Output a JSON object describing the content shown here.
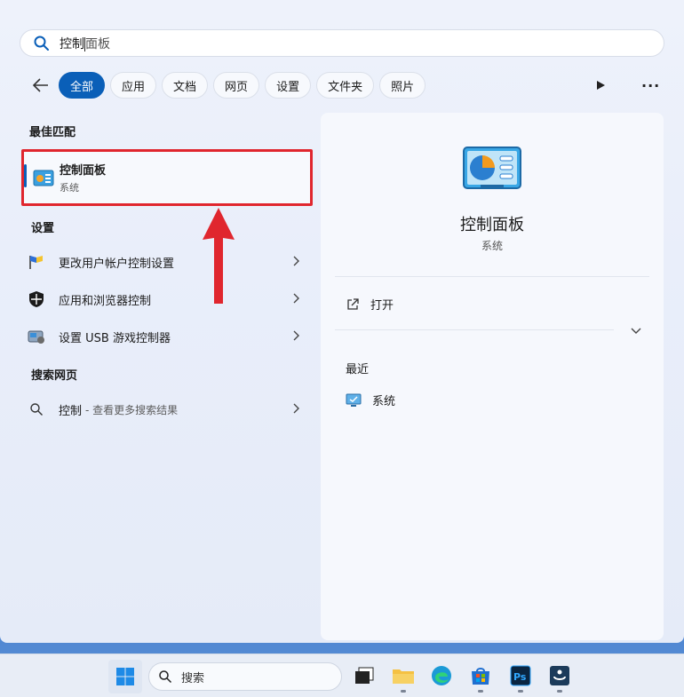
{
  "search": {
    "typed": "控制",
    "suggestion_rest": "面板"
  },
  "filters": {
    "tabs": [
      "全部",
      "应用",
      "文档",
      "网页",
      "设置",
      "文件夹",
      "照片"
    ],
    "active": "全部"
  },
  "best_match": {
    "heading": "最佳匹配",
    "name": "控制面板",
    "subtitle": "系统"
  },
  "settings": {
    "heading": "设置",
    "items": [
      {
        "label": "更改用户帐户控制设置",
        "icon": "uac-flag-icon"
      },
      {
        "label": "应用和浏览器控制",
        "icon": "shield-icon"
      },
      {
        "label": "设置 USB 游戏控制器",
        "icon": "game-controller-icon"
      }
    ]
  },
  "web": {
    "heading": "搜索网页",
    "query": "控制",
    "suffix": "- 查看更多搜索结果"
  },
  "detail": {
    "title": "控制面板",
    "subtitle": "系统",
    "open_label": "打开",
    "recent_heading": "最近",
    "recent_items": [
      "系统"
    ]
  },
  "taskbar": {
    "search_placeholder": "搜索",
    "apps": [
      "task-view-icon",
      "file-explorer-icon",
      "edge-icon",
      "store-icon",
      "photoshop-icon",
      "app-icon"
    ]
  },
  "colors": {
    "accent": "#0a5fb8",
    "highlight_border": "#e0262e"
  }
}
